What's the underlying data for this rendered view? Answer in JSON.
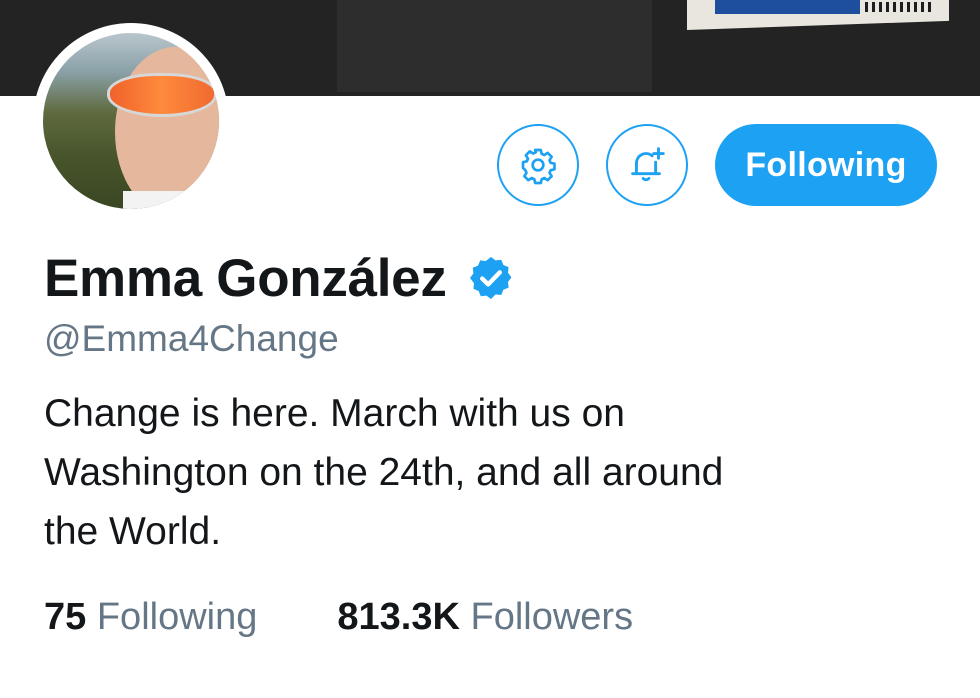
{
  "profile": {
    "display_name": "Emma González",
    "handle": "@Emma4Change",
    "verified": true,
    "bio_lines": [
      "Change is here. March with us on",
      "Washington on the 24th, and all around",
      "the World."
    ]
  },
  "actions": {
    "settings_icon": "gear-icon",
    "notifications_icon": "bell-plus-icon",
    "follow_label": "Following"
  },
  "stats": {
    "following_count": "75",
    "following_label": "Following",
    "followers_count": "813.3K",
    "followers_label": "Followers"
  },
  "colors": {
    "accent": "#1da1f2",
    "text_primary": "#14171a",
    "text_secondary": "#657786",
    "banner": "#232323"
  }
}
